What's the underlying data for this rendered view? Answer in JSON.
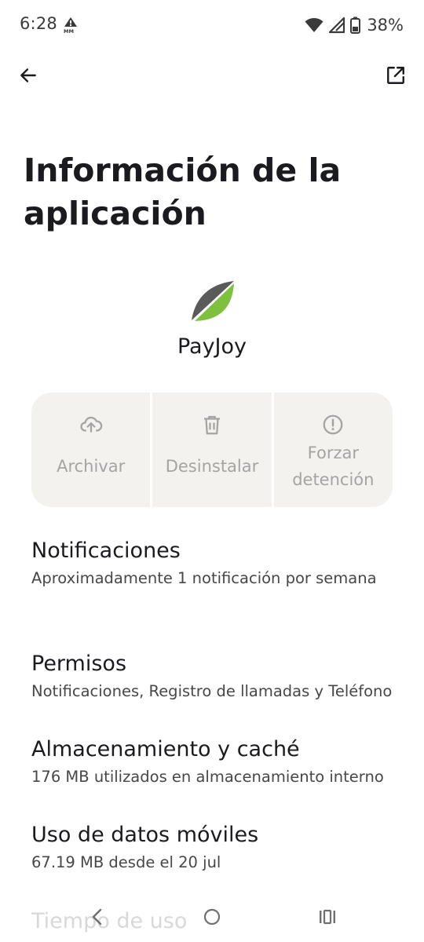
{
  "status_bar": {
    "time": "6:28",
    "battery_percent": "38%",
    "icons": [
      "carrier-alert-icon",
      "wifi-icon",
      "signal-icon",
      "battery-icon"
    ]
  },
  "app_bar": {
    "back_icon": "arrow-left-icon",
    "open_icon": "open-in-new-icon"
  },
  "page": {
    "title": "Información de la aplicación"
  },
  "app": {
    "name": "PayJoy",
    "icon": "payjoy-logo",
    "brand_colors": {
      "dark": "#5a5a5a",
      "green": "#7ec13e"
    }
  },
  "actions": [
    {
      "label": "Archivar",
      "icon": "cloud-upload-icon"
    },
    {
      "label": "Desinstalar",
      "icon": "trash-icon"
    },
    {
      "label": "Forzar detención",
      "icon": "alert-circle-icon"
    }
  ],
  "settings": [
    {
      "title": "Notificaciones",
      "summary": "Aproximadamente 1 notificación por semana"
    },
    {
      "title": "Permisos",
      "summary": "Notificaciones, Registro de llamadas y Teléfono"
    },
    {
      "title": "Almacenamiento y caché",
      "summary": "176 MB utilizados en almacenamiento interno"
    },
    {
      "title": "Uso de datos móviles",
      "summary": "67.19 MB desde el 20 jul"
    },
    {
      "title": "Tiempo de uso"
    }
  ],
  "nav_bar": {
    "icons": [
      "nav-back-icon",
      "nav-home-icon",
      "nav-recents-icon"
    ]
  },
  "colors": {
    "background": "#ffffff",
    "text_primary": "#1b1b1f",
    "text_secondary": "#474747",
    "action_bg": "#f3f2ef",
    "action_disabled": "#a4a4a2"
  }
}
